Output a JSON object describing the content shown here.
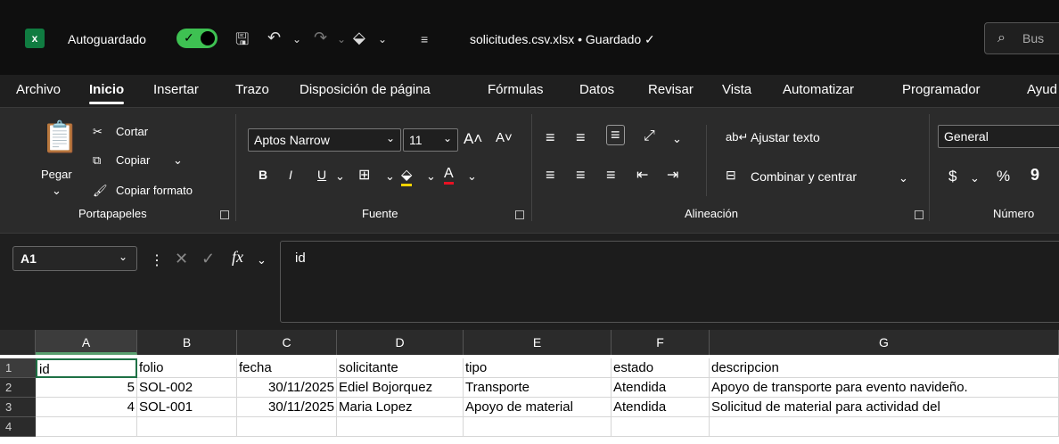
{
  "titlebar": {
    "autosave_label": "Autoguardado",
    "filename": "solicitudes.csv.xlsx • Guardado ✓",
    "search_placeholder": "Bus"
  },
  "menu": [
    "Archivo",
    "Inicio",
    "Insertar",
    "Trazo",
    "Disposición de página",
    "Fórmulas",
    "Datos",
    "Revisar",
    "Vista",
    "Automatizar",
    "Programador",
    "Ayud"
  ],
  "ribbon": {
    "clipboard": {
      "paste": "Pegar",
      "cut": "Cortar",
      "copy": "Copiar",
      "format_painter": "Copiar formato",
      "label": "Portapapeles"
    },
    "font": {
      "name": "Aptos Narrow",
      "size": "11",
      "bold": "B",
      "italic": "I",
      "underline": "U",
      "label": "Fuente"
    },
    "alignment": {
      "wrap": "Ajustar texto",
      "merge": "Combinar y centrar",
      "label": "Alineación"
    },
    "number": {
      "format": "General",
      "label": "Número"
    }
  },
  "formula_bar": {
    "cell_ref": "A1",
    "fx": "fx",
    "content": "id"
  },
  "columns": [
    "A",
    "B",
    "C",
    "D",
    "E",
    "F",
    "G"
  ],
  "rows": [
    {
      "n": "1",
      "cells": [
        "id",
        "folio",
        "fecha",
        "solicitante",
        "tipo",
        "estado",
        "descripcion"
      ]
    },
    {
      "n": "2",
      "cells": [
        "5",
        "SOL-002",
        "30/11/2025",
        "Ediel Bojorquez",
        "Transporte",
        "Atendida",
        "Apoyo de transporte para evento navideño."
      ]
    },
    {
      "n": "3",
      "cells": [
        "4",
        "SOL-001",
        "30/11/2025",
        "Maria Lopez",
        "Apoyo de material",
        "Atendida",
        "Solicitud de material para actividad del"
      ]
    },
    {
      "n": "4",
      "cells": [
        "",
        "",
        "",
        "",
        "",
        "",
        ""
      ]
    }
  ],
  "colors": {
    "accent": "#107c41",
    "toggle": "#3ec152"
  }
}
